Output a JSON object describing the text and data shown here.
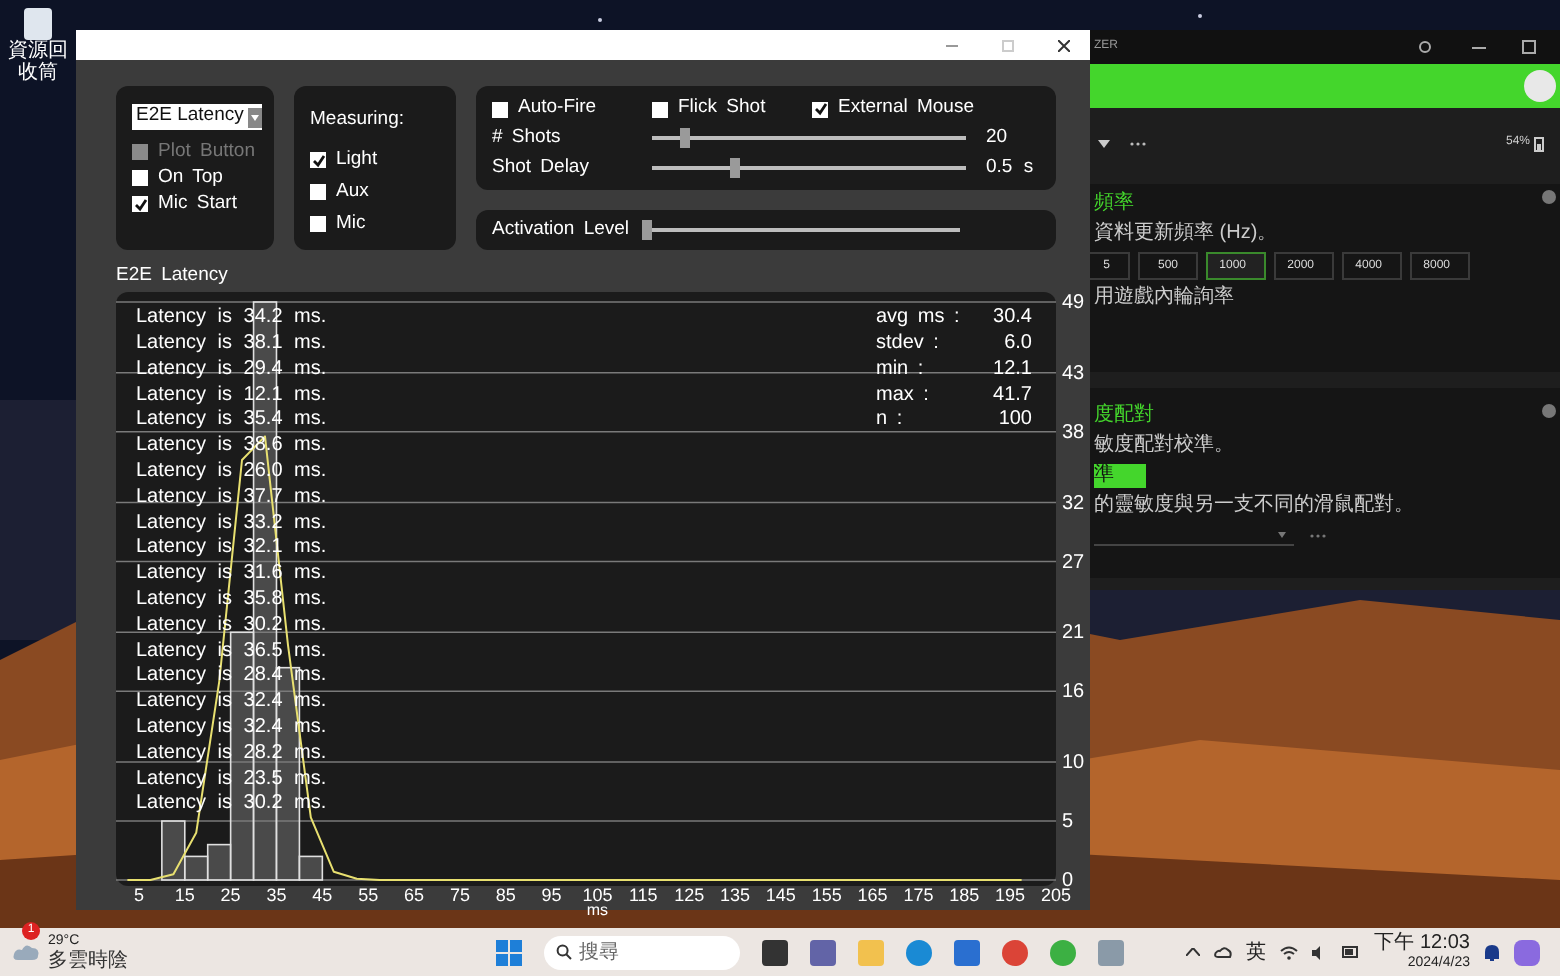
{
  "desktop": {
    "icons": [
      {
        "label": "資源回收筒"
      }
    ]
  },
  "main_window": {
    "mode_select": {
      "value": "E2E Latency"
    },
    "options": [
      {
        "label": "Plot Button",
        "checked": false,
        "disabled": true
      },
      {
        "label": "On Top",
        "checked": false,
        "disabled": false
      },
      {
        "label": "Mic Start",
        "checked": true,
        "disabled": false
      }
    ],
    "measuring": {
      "label": "Measuring:",
      "options": [
        {
          "label": "Light",
          "checked": true
        },
        {
          "label": "Aux",
          "checked": false
        },
        {
          "label": "Mic",
          "checked": false
        }
      ]
    },
    "fire_options": [
      {
        "label": "Auto-Fire",
        "checked": false
      },
      {
        "label": "Flick Shot",
        "checked": false
      },
      {
        "label": "External Mouse",
        "checked": true
      }
    ],
    "sliders": [
      {
        "label": "# Shots",
        "level": 0.1,
        "reading": "20"
      },
      {
        "label": "Shot Delay",
        "level": 0.26,
        "reading": "0.5 s"
      }
    ],
    "activation": {
      "label": "Activation Level",
      "level": 0.0
    },
    "chart_title": "E2E Latency",
    "log": [
      "Latency is 34.2 ms.",
      "Latency is 38.1 ms.",
      "Latency is 29.4 ms.",
      "Latency is 12.1 ms.",
      "Latency is 35.4 ms.",
      "Latency is 38.6 ms.",
      "Latency is 26.0 ms.",
      "Latency is 37.7 ms.",
      "Latency is 33.2 ms.",
      "Latency is 32.1 ms.",
      "Latency is 31.6 ms.",
      "Latency is 35.8 ms.",
      "Latency is 30.2 ms.",
      "Latency is 36.5 ms.",
      "Latency is 28.4 ms.",
      "Latency is 32.4 ms.",
      "Latency is 32.4 ms.",
      "Latency is 28.2 ms.",
      "Latency is 23.5 ms.",
      "Latency is 30.2 ms."
    ],
    "stats": [
      {
        "label": "avg ms :",
        "value": "30.4"
      },
      {
        "label": "stdev :",
        "value": "6.0"
      },
      {
        "label": "min :",
        "value": "12.1"
      },
      {
        "label": "max :",
        "value": "41.7"
      },
      {
        "label": "n :",
        "value": "100"
      }
    ],
    "chart_data": {
      "type": "bar",
      "xlabel": "ms",
      "grid": true,
      "x": [
        2.5,
        7.5,
        12.5,
        17.5,
        22.5,
        27.5,
        32.5,
        37.5,
        42.5,
        47.5,
        52.5,
        57.5,
        197.5
      ],
      "series": [
        {
          "type": "bar",
          "color": "#7a7a7a",
          "values": [
            0,
            0,
            5,
            2,
            3,
            21,
            49,
            18,
            2,
            0,
            0,
            0,
            0
          ]
        },
        {
          "type": "line",
          "color": "#e8e070",
          "values": [
            0,
            0,
            0.5,
            4.0,
            16.8,
            35.6,
            37.6,
            19.9,
            5.3,
            0.7,
            0.1,
            0,
            0
          ]
        }
      ],
      "xlim": [
        0,
        205
      ],
      "ylim": [
        0,
        49
      ],
      "xticks": [
        5,
        15,
        25,
        35,
        45,
        55,
        65,
        75,
        85,
        95,
        105,
        115,
        125,
        135,
        145,
        155,
        165,
        175,
        185,
        195,
        205
      ],
      "yticks": [
        0,
        5,
        10,
        16,
        21,
        27,
        32,
        38,
        43,
        49
      ]
    }
  },
  "razer_window": {
    "title": "ZER",
    "battery": "54%",
    "polling": {
      "title": "頻率",
      "description": "資料更新頻率 (Hz)。",
      "rates": [
        {
          "label": "5",
          "selected": false
        },
        {
          "label": "500",
          "selected": false
        },
        {
          "label": "1000",
          "selected": true
        },
        {
          "label": "2000",
          "selected": false
        },
        {
          "label": "4000",
          "selected": false
        },
        {
          "label": "8000",
          "selected": false
        }
      ],
      "note": "用遊戲內輪詢率"
    },
    "sensitivity": {
      "title": "度配對",
      "description": "敏度配對校準。",
      "button": "準",
      "note": "的靈敏度與另一支不同的滑鼠配對。"
    }
  },
  "taskbar": {
    "weather": {
      "badge": "1",
      "temp": "29°C",
      "condition": "多雲時陰"
    },
    "search": {
      "placeholder": "搜尋"
    },
    "ime": "英",
    "time": "下午 12:03",
    "date": "2024/4/23"
  }
}
